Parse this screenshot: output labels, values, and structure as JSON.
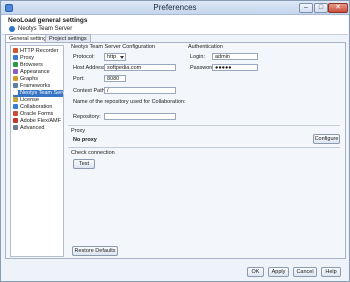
{
  "window": {
    "title": "Preferences",
    "min_label": "–",
    "max_label": "□",
    "close_label": "✕"
  },
  "header": {
    "title": "NeoLoad general settings",
    "subtitle": "Neotys Team Server"
  },
  "tabs": [
    {
      "label": "General settings",
      "active": true
    },
    {
      "label": "Project settings",
      "active": false
    }
  ],
  "tree": {
    "items": [
      {
        "label": "HTTP Recorder",
        "icon_color": "#d2532e",
        "selected": false
      },
      {
        "label": "Proxy",
        "icon_color": "#3a7bd5",
        "selected": false
      },
      {
        "label": "Browsers",
        "icon_color": "#2f9a46",
        "selected": false
      },
      {
        "label": "Appearance",
        "icon_color": "#8a5bc9",
        "selected": false
      },
      {
        "label": "Graphs",
        "icon_color": "#d59b2a",
        "selected": false
      },
      {
        "label": "Frameworks",
        "icon_color": "#5f7ca3",
        "selected": false
      },
      {
        "label": "Neotys Team Server",
        "icon_color": "#ffffff",
        "selected": true
      },
      {
        "label": "License",
        "icon_color": "#c9a23d",
        "selected": false
      },
      {
        "label": "Collaboration",
        "icon_color": "#3a7bd5",
        "selected": false
      },
      {
        "label": "Oracle Forms",
        "icon_color": "#d04a3a",
        "selected": false
      },
      {
        "label": "Adobe Flex/AMF",
        "icon_color": "#c23a2a",
        "selected": false
      },
      {
        "label": "Advanced",
        "icon_color": "#6d7c90",
        "selected": false
      }
    ]
  },
  "team_server": {
    "section_title": "Neotys Team Server Configuration",
    "protocol_label": "Protocol:",
    "protocol_value": "http",
    "host_label": "Host Address:",
    "host_value": "softpedia.com",
    "port_label": "Port:",
    "port_value": "8080",
    "context_label": "Context Path:",
    "context_value": "/",
    "repo_hint": "Name of the repository used for Collaboration:",
    "repo_label": "Repository:",
    "repo_value": ""
  },
  "auth": {
    "section_title": "Authentication",
    "login_label": "Login:",
    "login_value": "admin",
    "password_label": "Password:",
    "password_value": "●●●●●"
  },
  "proxy": {
    "section_title": "Proxy",
    "status": "No proxy",
    "configure_label": "Configure"
  },
  "check": {
    "section_title": "Check connection",
    "test_label": "Test"
  },
  "restore_label": "Restore Defaults",
  "footer": {
    "ok_label": "OK",
    "apply_label": "Apply",
    "cancel_label": "Cancel",
    "help_label": "Help"
  }
}
